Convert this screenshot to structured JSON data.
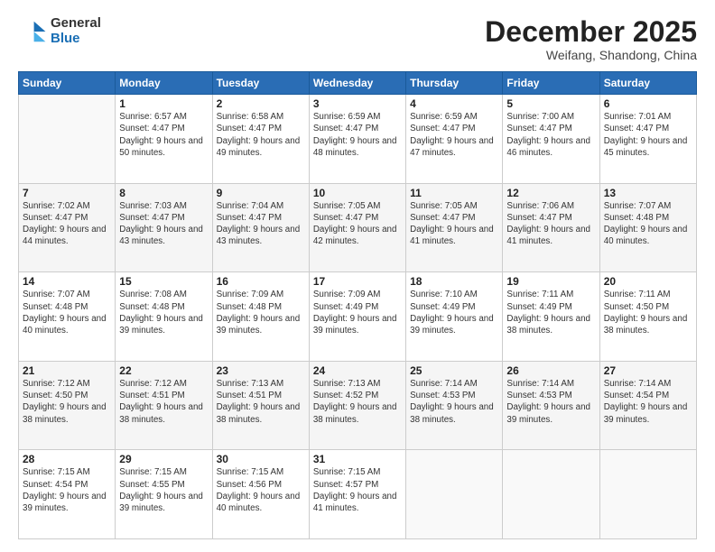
{
  "logo": {
    "general": "General",
    "blue": "Blue"
  },
  "header": {
    "month_year": "December 2025",
    "location": "Weifang, Shandong, China"
  },
  "weekdays": [
    "Sunday",
    "Monday",
    "Tuesday",
    "Wednesday",
    "Thursday",
    "Friday",
    "Saturday"
  ],
  "weeks": [
    [
      null,
      {
        "day": 1,
        "sunrise": "6:57 AM",
        "sunset": "4:47 PM",
        "daylight": "9 hours and 50 minutes."
      },
      {
        "day": 2,
        "sunrise": "6:58 AM",
        "sunset": "4:47 PM",
        "daylight": "9 hours and 49 minutes."
      },
      {
        "day": 3,
        "sunrise": "6:59 AM",
        "sunset": "4:47 PM",
        "daylight": "9 hours and 48 minutes."
      },
      {
        "day": 4,
        "sunrise": "6:59 AM",
        "sunset": "4:47 PM",
        "daylight": "9 hours and 47 minutes."
      },
      {
        "day": 5,
        "sunrise": "7:00 AM",
        "sunset": "4:47 PM",
        "daylight": "9 hours and 46 minutes."
      },
      {
        "day": 6,
        "sunrise": "7:01 AM",
        "sunset": "4:47 PM",
        "daylight": "9 hours and 45 minutes."
      }
    ],
    [
      {
        "day": 7,
        "sunrise": "7:02 AM",
        "sunset": "4:47 PM",
        "daylight": "9 hours and 44 minutes."
      },
      {
        "day": 8,
        "sunrise": "7:03 AM",
        "sunset": "4:47 PM",
        "daylight": "9 hours and 43 minutes."
      },
      {
        "day": 9,
        "sunrise": "7:04 AM",
        "sunset": "4:47 PM",
        "daylight": "9 hours and 43 minutes."
      },
      {
        "day": 10,
        "sunrise": "7:05 AM",
        "sunset": "4:47 PM",
        "daylight": "9 hours and 42 minutes."
      },
      {
        "day": 11,
        "sunrise": "7:05 AM",
        "sunset": "4:47 PM",
        "daylight": "9 hours and 41 minutes."
      },
      {
        "day": 12,
        "sunrise": "7:06 AM",
        "sunset": "4:47 PM",
        "daylight": "9 hours and 41 minutes."
      },
      {
        "day": 13,
        "sunrise": "7:07 AM",
        "sunset": "4:48 PM",
        "daylight": "9 hours and 40 minutes."
      }
    ],
    [
      {
        "day": 14,
        "sunrise": "7:07 AM",
        "sunset": "4:48 PM",
        "daylight": "9 hours and 40 minutes."
      },
      {
        "day": 15,
        "sunrise": "7:08 AM",
        "sunset": "4:48 PM",
        "daylight": "9 hours and 39 minutes."
      },
      {
        "day": 16,
        "sunrise": "7:09 AM",
        "sunset": "4:48 PM",
        "daylight": "9 hours and 39 minutes."
      },
      {
        "day": 17,
        "sunrise": "7:09 AM",
        "sunset": "4:49 PM",
        "daylight": "9 hours and 39 minutes."
      },
      {
        "day": 18,
        "sunrise": "7:10 AM",
        "sunset": "4:49 PM",
        "daylight": "9 hours and 39 minutes."
      },
      {
        "day": 19,
        "sunrise": "7:11 AM",
        "sunset": "4:49 PM",
        "daylight": "9 hours and 38 minutes."
      },
      {
        "day": 20,
        "sunrise": "7:11 AM",
        "sunset": "4:50 PM",
        "daylight": "9 hours and 38 minutes."
      }
    ],
    [
      {
        "day": 21,
        "sunrise": "7:12 AM",
        "sunset": "4:50 PM",
        "daylight": "9 hours and 38 minutes."
      },
      {
        "day": 22,
        "sunrise": "7:12 AM",
        "sunset": "4:51 PM",
        "daylight": "9 hours and 38 minutes."
      },
      {
        "day": 23,
        "sunrise": "7:13 AM",
        "sunset": "4:51 PM",
        "daylight": "9 hours and 38 minutes."
      },
      {
        "day": 24,
        "sunrise": "7:13 AM",
        "sunset": "4:52 PM",
        "daylight": "9 hours and 38 minutes."
      },
      {
        "day": 25,
        "sunrise": "7:14 AM",
        "sunset": "4:53 PM",
        "daylight": "9 hours and 38 minutes."
      },
      {
        "day": 26,
        "sunrise": "7:14 AM",
        "sunset": "4:53 PM",
        "daylight": "9 hours and 39 minutes."
      },
      {
        "day": 27,
        "sunrise": "7:14 AM",
        "sunset": "4:54 PM",
        "daylight": "9 hours and 39 minutes."
      }
    ],
    [
      {
        "day": 28,
        "sunrise": "7:15 AM",
        "sunset": "4:54 PM",
        "daylight": "9 hours and 39 minutes."
      },
      {
        "day": 29,
        "sunrise": "7:15 AM",
        "sunset": "4:55 PM",
        "daylight": "9 hours and 39 minutes."
      },
      {
        "day": 30,
        "sunrise": "7:15 AM",
        "sunset": "4:56 PM",
        "daylight": "9 hours and 40 minutes."
      },
      {
        "day": 31,
        "sunrise": "7:15 AM",
        "sunset": "4:57 PM",
        "daylight": "9 hours and 41 minutes."
      },
      null,
      null,
      null
    ]
  ]
}
